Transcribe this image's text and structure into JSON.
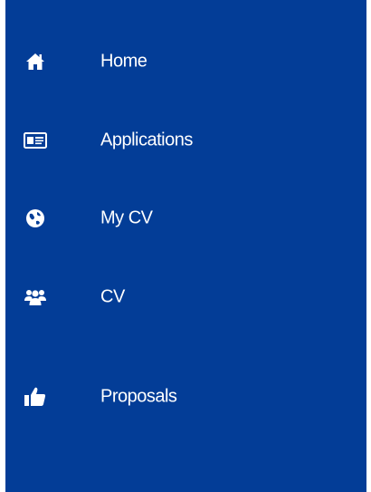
{
  "sidebar": {
    "background": "#033d97",
    "items": [
      {
        "label": "Home",
        "icon": "home-icon"
      },
      {
        "label": "Applications",
        "icon": "id-card-icon"
      },
      {
        "label": "My CV",
        "icon": "globe-icon"
      },
      {
        "label": "CV",
        "icon": "users-icon"
      },
      {
        "label": "Proposals",
        "icon": "thumbs-up-icon"
      }
    ]
  }
}
